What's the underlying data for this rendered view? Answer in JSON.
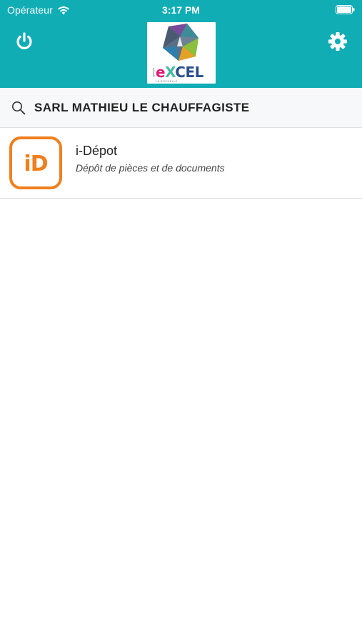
{
  "status_bar": {
    "carrier": "Opérateur",
    "time": "3:17 PM"
  },
  "header": {
    "logo_brand_letter_e": "e",
    "logo_brand_letter_x": "X",
    "logo_brand_rest": "CEL",
    "logo_location": "LA ROCHELLE",
    "logo_small": "groupe",
    "colors": {
      "background": "#10adb5",
      "icon": "#ffffff"
    }
  },
  "search": {
    "value": "SARL MATHIEU LE CHAUFFAGISTE"
  },
  "apps": [
    {
      "icon_text": "iD",
      "title": "i-Dépot",
      "subtitle": "Dépôt de pièces et de documents",
      "accent": "#f0801f"
    }
  ]
}
